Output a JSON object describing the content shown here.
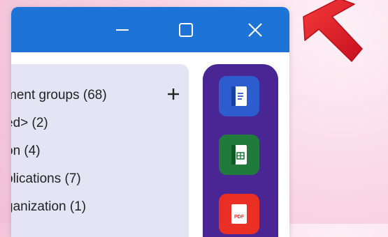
{
  "window": {
    "controls": {
      "minimize": "minimize-icon",
      "maximize": "maximize-icon",
      "close": "close-icon"
    }
  },
  "groups_panel": {
    "items": [
      {
        "label": "ment groups (68)"
      },
      {
        "label": "ed> (2)"
      },
      {
        "label": "on (4)"
      },
      {
        "label": "plications (7)"
      },
      {
        "label": "ganization (1)"
      }
    ],
    "add_button_icon": "plus-icon"
  },
  "dock": {
    "apps": [
      {
        "icon": "word-document-icon",
        "color": "#2d5ccf"
      },
      {
        "icon": "spreadsheet-icon",
        "color": "#1f7a3c"
      },
      {
        "icon": "pdf-icon",
        "color": "#ea2f24",
        "badge": "PDF"
      }
    ]
  },
  "colors": {
    "titlebar": "#1e73d6",
    "panel": "#e4e4f5",
    "dock": "#4a2694",
    "cursor": "#e8212c"
  }
}
